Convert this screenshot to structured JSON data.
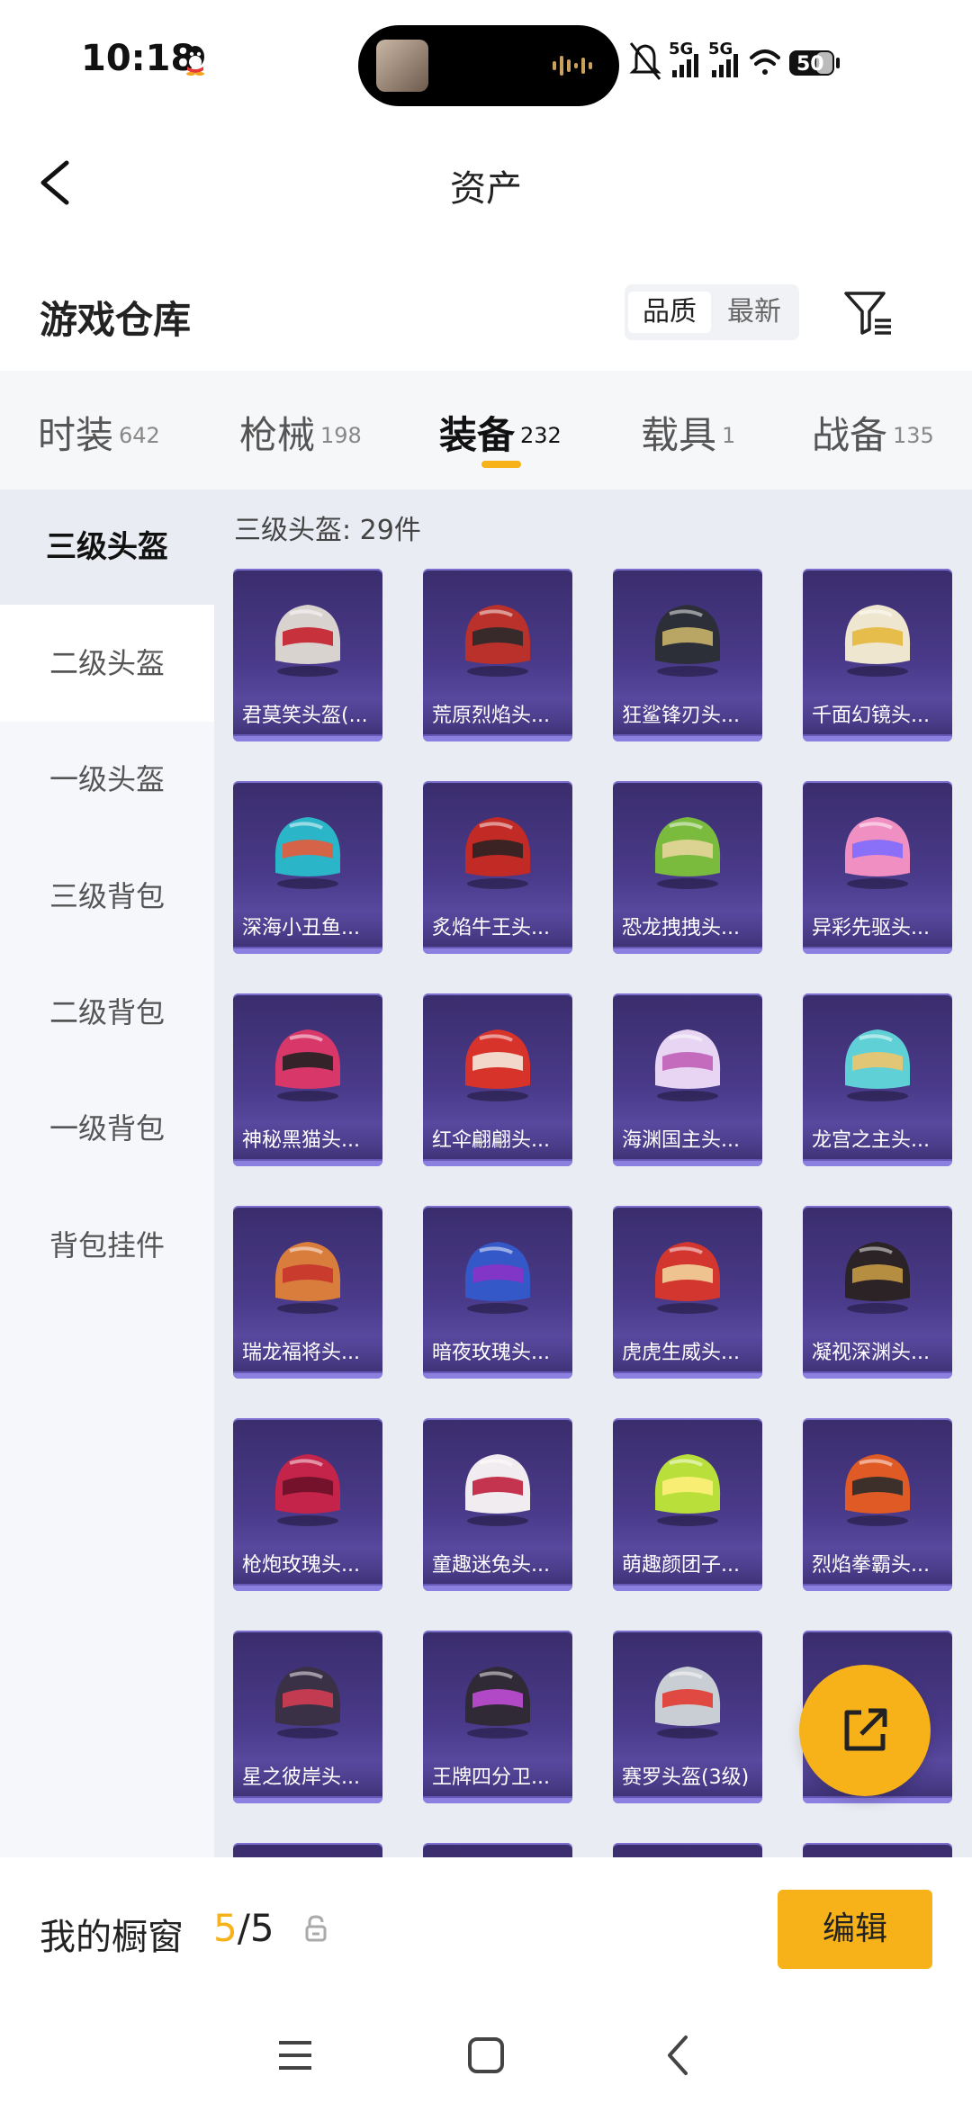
{
  "status_bar": {
    "time": "10:18",
    "signal_1": "5G",
    "signal_2": "5G",
    "battery": "50"
  },
  "header": {
    "title": "资产"
  },
  "section": {
    "title": "游戏仓库",
    "sort_options": [
      "品质",
      "最新"
    ]
  },
  "tabs": [
    {
      "label": "时装",
      "count": "642"
    },
    {
      "label": "枪械",
      "count": "198"
    },
    {
      "label": "装备",
      "count": "232"
    },
    {
      "label": "载具",
      "count": "1"
    },
    {
      "label": "战备",
      "count": "135"
    }
  ],
  "sidebar": {
    "items": [
      "三级头盔",
      "二级头盔",
      "一级头盔",
      "三级背包",
      "二级背包",
      "一级背包",
      "背包挂件"
    ]
  },
  "content": {
    "count_label": "三级头盔: 29件",
    "items": [
      {
        "name": "君莫笑头盔(...",
        "color": "#d9d3d0",
        "accent": "#c41f2b"
      },
      {
        "name": "荒原烈焰头...",
        "color": "#b9312a",
        "accent": "#2a2a2a"
      },
      {
        "name": "狂鲨锋刃头...",
        "color": "#2d2f38",
        "accent": "#c9b46a"
      },
      {
        "name": "千面幻镜头...",
        "color": "#efe6cf",
        "accent": "#e4b73c"
      },
      {
        "name": "深海小丑鱼...",
        "color": "#2bb5c8",
        "accent": "#e85a3a"
      },
      {
        "name": "炙焰牛王头...",
        "color": "#c12a25",
        "accent": "#2b2222"
      },
      {
        "name": "恐龙拽拽头...",
        "color": "#7abb3e",
        "accent": "#e7d59a"
      },
      {
        "name": "异彩先驱头...",
        "color": "#f08fc2",
        "accent": "#7e6bff"
      },
      {
        "name": "神秘黑猫头...",
        "color": "#d8376a",
        "accent": "#222222"
      },
      {
        "name": "红伞翩翩头...",
        "color": "#d8332a",
        "accent": "#f4eadb"
      },
      {
        "name": "海渊国主头...",
        "color": "#e7d5f3",
        "accent": "#c15fb8"
      },
      {
        "name": "龙宫之主头...",
        "color": "#5fd0d6",
        "accent": "#f0c56a"
      },
      {
        "name": "瑞龙福将头...",
        "color": "#d97d3c",
        "accent": "#c7352b"
      },
      {
        "name": "暗夜玫瑰头...",
        "color": "#3458c8",
        "accent": "#8a33c7"
      },
      {
        "name": "虎虎生威头...",
        "color": "#d2362e",
        "accent": "#f2d39b"
      },
      {
        "name": "凝视深渊头...",
        "color": "#2b2326",
        "accent": "#c49a45"
      },
      {
        "name": "枪炮玫瑰头...",
        "color": "#c4234a",
        "accent": "#6d1128"
      },
      {
        "name": "童趣迷兔头...",
        "color": "#f1ecef",
        "accent": "#c0203c"
      },
      {
        "name": "萌趣颜团子...",
        "color": "#b9e03a",
        "accent": "#fff07a"
      },
      {
        "name": "烈焰拳霸头...",
        "color": "#e05a26",
        "accent": "#2b2b2b"
      },
      {
        "name": "星之彼岸头...",
        "color": "#3b3146",
        "accent": "#d23d52"
      },
      {
        "name": "王牌四分卫...",
        "color": "#2f2a36",
        "accent": "#c04bd6"
      },
      {
        "name": "赛罗头盔(3级)",
        "color": "#c9cdd4",
        "accent": "#e23b32"
      },
      {
        "name": "",
        "color": "#e9a6c3",
        "accent": "#f7b21a"
      }
    ]
  },
  "bottom": {
    "showcase_label": "我的橱窗",
    "showcase_current": "5",
    "showcase_total": "/5",
    "edit_label": "编辑"
  },
  "colors": {
    "accent": "#f7b21a",
    "card_bg": "#45378a",
    "content_bg": "#e9ecf2"
  }
}
